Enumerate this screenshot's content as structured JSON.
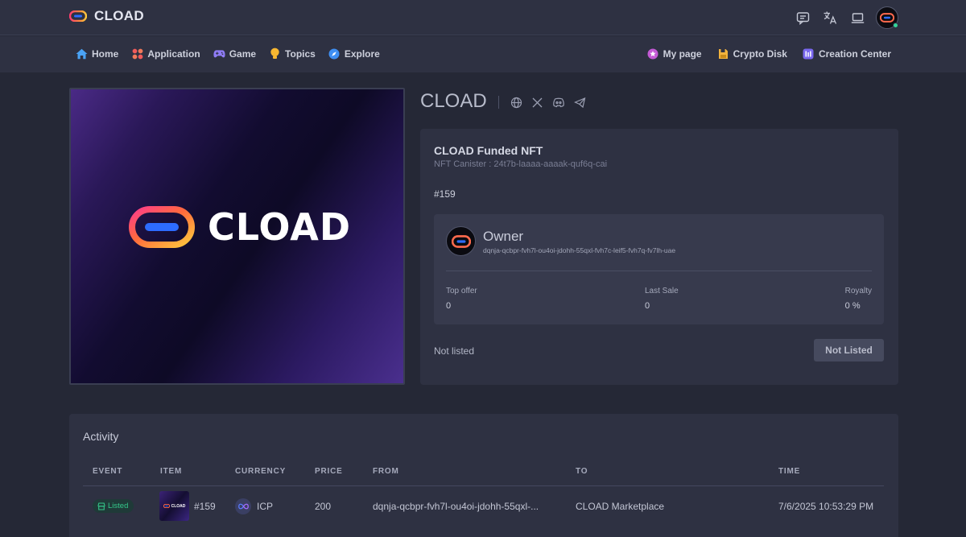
{
  "app": {
    "name": "CLOAD"
  },
  "top_actions": {
    "icons": [
      "chat-icon",
      "translate-icon",
      "laptop-icon",
      "avatar"
    ]
  },
  "nav": {
    "left": [
      {
        "label": "Home",
        "icon": "home-icon"
      },
      {
        "label": "Application",
        "icon": "apps-icon"
      },
      {
        "label": "Game",
        "icon": "gamepad-icon"
      },
      {
        "label": "Topics",
        "icon": "bulb-icon"
      },
      {
        "label": "Explore",
        "icon": "compass-icon"
      }
    ],
    "right": [
      {
        "label": "My page",
        "icon": "mypage-icon"
      },
      {
        "label": "Crypto Disk",
        "icon": "disk-icon"
      },
      {
        "label": "Creation Center",
        "icon": "creation-icon"
      }
    ]
  },
  "image": {
    "logo_text": "CLOAD"
  },
  "collection": {
    "title": "CLOAD",
    "socials": [
      "globe-icon",
      "x-icon",
      "discord-icon",
      "telegram-icon"
    ]
  },
  "nft": {
    "name": "CLOAD Funded NFT",
    "canister": "NFT Canister : 24t7b-laaaa-aaaak-quf6q-cai",
    "number": "#159",
    "owner_label": "Owner",
    "owner_address": "dqnja-qcbpr-fvh7l-ou4oi-jdohh-55qxl-fvh7c-leif5-fvh7q-fv7lh-uae",
    "stats": [
      {
        "label": "Top offer",
        "value": "0"
      },
      {
        "label": "Last Sale",
        "value": "0"
      },
      {
        "label": "Royalty",
        "value": "0 %"
      }
    ],
    "listing_status": "Not listed",
    "listing_button": "Not Listed"
  },
  "activity": {
    "title": "Activity",
    "columns": [
      "EVENT",
      "ITEM",
      "CURRENCY",
      "PRICE",
      "FROM",
      "TO",
      "TIME"
    ],
    "rows": [
      {
        "event": "Listed",
        "item_thumb_text": "CLOAD",
        "item": "#159",
        "currency": "ICP",
        "price": "200",
        "from": "dqnja-qcbpr-fvh7l-ou4oi-jdohh-55qxl-...",
        "to": "CLOAD Marketplace",
        "time": "7/6/2025 10:53:29 PM"
      }
    ]
  },
  "colors": {
    "background": "#252836",
    "panel": "#2e3142",
    "accent_green": "#34c88a",
    "logo_gradient": [
      "#ff3d6e",
      "#ff8a3d",
      "#ffc93d",
      "#2d6cff"
    ]
  }
}
